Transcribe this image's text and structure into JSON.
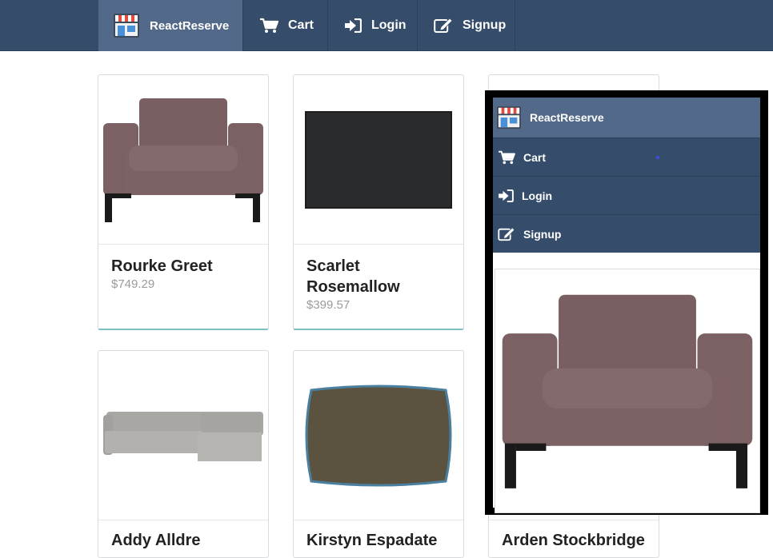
{
  "nav": {
    "brand": "ReactReserve",
    "items": [
      {
        "label": "Cart",
        "icon": "cart-icon"
      },
      {
        "label": "Login",
        "icon": "login-icon"
      },
      {
        "label": "Signup",
        "icon": "signup-icon"
      }
    ]
  },
  "products": [
    {
      "name": "Rourke Greet",
      "price": "$749.29",
      "image": "armchair-image"
    },
    {
      "name": "Scarlet Rosemallow",
      "price": "$399.57",
      "image": "rug-image"
    },
    {
      "name": "Addy Alldre",
      "price": "",
      "image": "sectional-sofa-image"
    },
    {
      "name": "Kirstyn Espadate",
      "price": "",
      "image": "pillow-image"
    },
    {
      "name": "Arden Stockbridge",
      "price": "",
      "image": "armchair-image"
    }
  ],
  "mobile_menu": {
    "brand": "ReactReserve",
    "items": [
      {
        "label": "Cart",
        "icon": "cart-icon"
      },
      {
        "label": "Login",
        "icon": "login-icon"
      },
      {
        "label": "Signup",
        "icon": "signup-icon"
      }
    ]
  },
  "colors": {
    "navbar": "#354d6a",
    "brand_active": "#52698a",
    "card_accent": "#7cc1c6",
    "price": "#9b9b9b"
  }
}
